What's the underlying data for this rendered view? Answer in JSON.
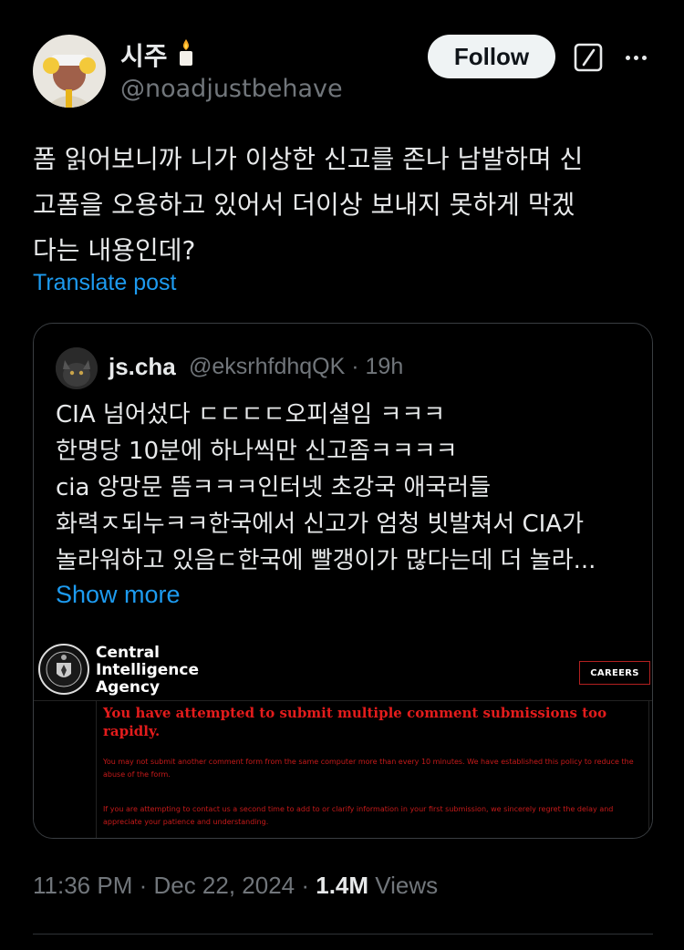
{
  "author": {
    "display_name": "시주",
    "handle": "@noadjustbehave"
  },
  "actions": {
    "follow_label": "Follow",
    "grok_icon": "grok-icon",
    "more_icon": "more-icon"
  },
  "tweet": {
    "lines": [
      "폼 읽어보니까 니가 이상한 신고를 존나 남발하며 신",
      "고폼을 오용하고 있어서 더이상 보내지 못하게 막겠",
      "다는 내용인데?"
    ],
    "translate_label": "Translate post"
  },
  "quote": {
    "name": "js.cha",
    "meta": "@eksrhfdhqQK · 19h",
    "lines": [
      "CIA 넘어섰다 ㄷㄷㄷㄷ오피셜임 ㅋㅋㅋ",
      "한명당 10분에 하나씩만 신고좀ㅋㅋㅋㅋ",
      "cia 앙망문 뜸ㅋㅋㅋ인터넷 초강국 애국러들",
      "화력ㅈ되누ㅋㅋ한국에서 신고가 엄청 빗발쳐서 CIA가",
      "놀라워하고 있음ㄷ한국에 빨갱이가 많다는데 더 놀라..."
    ],
    "show_more": "Show more",
    "image": {
      "agency_lines": [
        "Central",
        "Intelligence",
        "Agency"
      ],
      "careers": "CAREERS",
      "error_heading": "You have attempted to submit multiple comment submissions too rapidly.",
      "error_p1": "You may not submit another comment form from the same computer more than every 10 minutes. We have established this policy to reduce the abuse of the form.",
      "error_p2": "If you are attempting to contact us a second time to add to or clarify information in your first submission, we sincerely regret the delay and appreciate your patience and understanding."
    }
  },
  "footer": {
    "time_date": "11:36 PM · Dec 22, 2024 · ",
    "views_count": "1.4M",
    "views_label": " Views"
  },
  "colors": {
    "background": "#000000",
    "text": "#e7e9ea",
    "muted": "#71767b",
    "link": "#1d9bf0",
    "error_red": "#e31c1c"
  }
}
